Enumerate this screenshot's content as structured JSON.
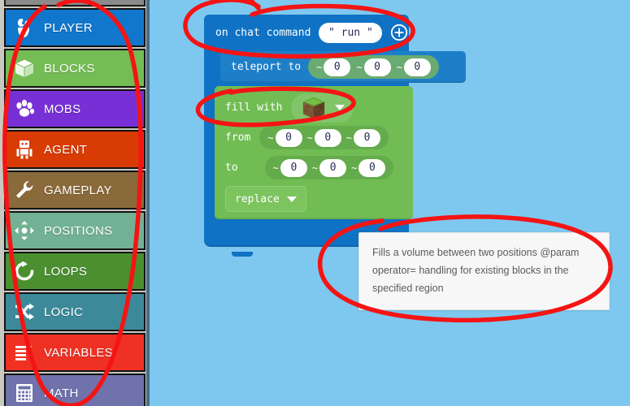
{
  "sidebar": {
    "partial_item_above": "",
    "items": [
      {
        "label": "PLAYER",
        "icon": "player-icon",
        "color": "#1177cc"
      },
      {
        "label": "BLOCKS",
        "icon": "cube-icon",
        "color": "#74bd54"
      },
      {
        "label": "MOBS",
        "icon": "paw-icon",
        "color": "#7730d6"
      },
      {
        "label": "AGENT",
        "icon": "robot-icon",
        "color": "#d83b04"
      },
      {
        "label": "GAMEPLAY",
        "icon": "wrench-icon",
        "color": "#8a6a3a"
      },
      {
        "label": "POSITIONS",
        "icon": "crosshair-icon",
        "color": "#72b194"
      },
      {
        "label": "LOOPS",
        "icon": "refresh-icon",
        "color": "#4b8f31"
      },
      {
        "label": "LOGIC",
        "icon": "shuffle-icon",
        "color": "#3c8a99"
      },
      {
        "label": "VARIABLES",
        "icon": "list-icon",
        "color": "#ef3124"
      },
      {
        "label": "MATH",
        "icon": "calculator-icon",
        "color": "#6f72ab"
      }
    ]
  },
  "workspace": {
    "background_color": "#7ec8f0",
    "event_block": {
      "label": "on chat command",
      "command_value": "\" run \"",
      "add_icon": "plus-circle-icon",
      "color": "#0f72c4"
    },
    "teleport_block": {
      "label": "teleport to",
      "color": "#1e7fc9",
      "position": {
        "x": {
          "relative": "~",
          "value": "0"
        },
        "y": {
          "relative": "~",
          "value": "0"
        },
        "z": {
          "relative": "~",
          "value": "0"
        }
      }
    },
    "fill_block": {
      "color": "#71bd54",
      "fill_with_label": "fill with",
      "block_value_icon": "grass-block-icon",
      "block_dropdown_icon": "caret-down-icon",
      "from_label": "from",
      "from_position": {
        "x": {
          "relative": "~",
          "value": "0"
        },
        "y": {
          "relative": "~",
          "value": "0"
        },
        "z": {
          "relative": "~",
          "value": "0"
        }
      },
      "to_label": "to",
      "to_position": {
        "x": {
          "relative": "~",
          "value": "0"
        },
        "y": {
          "relative": "~",
          "value": "0"
        },
        "z": {
          "relative": "~",
          "value": "0"
        }
      },
      "operator_value": "replace",
      "operator_dropdown_icon": "caret-down-icon"
    }
  },
  "tooltip": {
    "text": "Fills a volume between two positions @param operator= handling for existing blocks in the specified region"
  },
  "annotations": {
    "color": "#f41414",
    "marks": [
      {
        "name": "sidebar-circle",
        "shape": "ellipse"
      },
      {
        "name": "event-block-circle",
        "shape": "ellipse"
      },
      {
        "name": "fill-with-circle",
        "shape": "ellipse"
      },
      {
        "name": "tooltip-circle",
        "shape": "ellipse"
      }
    ]
  }
}
